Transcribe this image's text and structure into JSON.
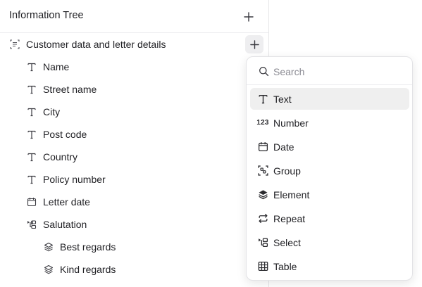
{
  "panel": {
    "title": "Information Tree",
    "root": {
      "label": "Customer data and letter details",
      "icon": "group-icon"
    },
    "fields": [
      {
        "label": "Name",
        "icon": "text-icon"
      },
      {
        "label": "Street name",
        "icon": "text-icon"
      },
      {
        "label": "City",
        "icon": "text-icon"
      },
      {
        "label": "Post code",
        "icon": "text-icon"
      },
      {
        "label": "Country",
        "icon": "text-icon"
      },
      {
        "label": "Policy number",
        "icon": "text-icon"
      },
      {
        "label": "Letter date",
        "icon": "calendar-icon"
      },
      {
        "label": "Salutation",
        "icon": "select-icon"
      }
    ],
    "options": [
      {
        "label": "Best regards",
        "icon": "layers-icon"
      },
      {
        "label": "Kind regards",
        "icon": "layers-icon"
      }
    ]
  },
  "dropdown": {
    "search_placeholder": "Search",
    "items": [
      {
        "label": "Text",
        "icon": "text-icon",
        "active": true
      },
      {
        "label": "Number",
        "icon": "number-icon",
        "glyph": "123"
      },
      {
        "label": "Date",
        "icon": "calendar-icon"
      },
      {
        "label": "Group",
        "icon": "group-icon"
      },
      {
        "label": "Element",
        "icon": "layers-filled-icon"
      },
      {
        "label": "Repeat",
        "icon": "repeat-icon"
      },
      {
        "label": "Select",
        "icon": "select-icon"
      },
      {
        "label": "Table",
        "icon": "table-icon"
      }
    ]
  }
}
